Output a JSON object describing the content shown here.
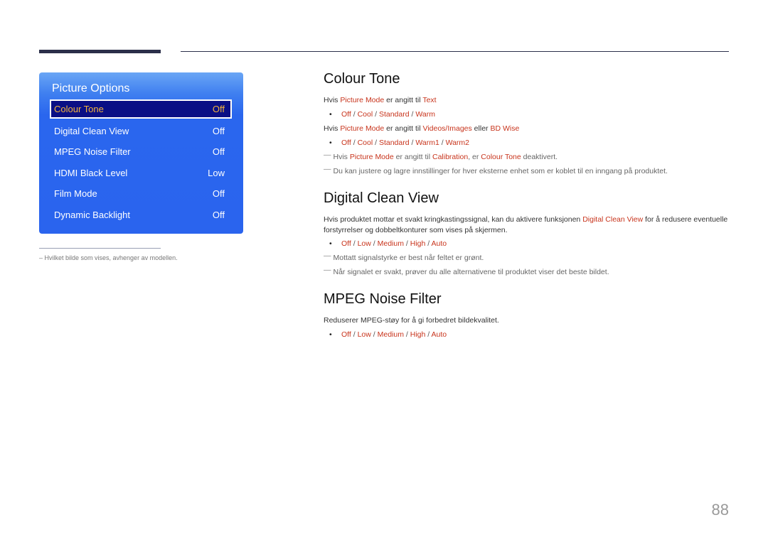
{
  "menu": {
    "title": "Picture Options",
    "items": [
      {
        "label": "Colour Tone",
        "value": "Off",
        "selected": true
      },
      {
        "label": "Digital Clean View",
        "value": "Off"
      },
      {
        "label": "MPEG Noise Filter",
        "value": "Off"
      },
      {
        "label": "HDMI Black Level",
        "value": "Low"
      },
      {
        "label": "Film Mode",
        "value": "Off"
      },
      {
        "label": "Dynamic Backlight",
        "value": "Off"
      }
    ]
  },
  "footnote": "– Hvilket bilde som vises, avhenger av modellen.",
  "sections": {
    "colour_tone": {
      "title": "Colour Tone",
      "cond1": {
        "pre": "Hvis ",
        "hl1": "Picture Mode",
        "mid": " er angitt til ",
        "hl2": "Text"
      },
      "opts1": [
        "Off",
        "Cool",
        "Standard",
        "Warm"
      ],
      "cond2": {
        "pre": "Hvis ",
        "hl1": "Picture Mode",
        "mid": " er angitt til ",
        "hl2": "Videos/Images",
        "mid2": " eller ",
        "hl3": "BD Wise"
      },
      "opts2": [
        "Off",
        "Cool",
        "Standard",
        "Warm1",
        "Warm2"
      ],
      "note1": {
        "pre": "Hvis ",
        "hl1": "Picture Mode",
        "mid": " er angitt til ",
        "hl2": "Calibration",
        "mid2": ", er ",
        "hl3": "Colour Tone",
        "post": " deaktivert."
      },
      "note2": "Du kan justere og lagre innstillinger for hver eksterne enhet som er koblet til en inngang på produktet."
    },
    "digital_clean_view": {
      "title": "Digital Clean View",
      "desc_pre": "Hvis produktet mottar et svakt kringkastingssignal, kan du aktivere funksjonen ",
      "desc_hl": "Digital Clean View",
      "desc_post": " for å redusere eventuelle forstyrrelser og dobbeltkonturer som vises på skjermen.",
      "opts": [
        "Off",
        "Low",
        "Medium",
        "High",
        "Auto"
      ],
      "note1": "Mottatt signalstyrke er best når feltet er grønt.",
      "note2": "Når signalet er svakt, prøver du alle alternativene til produktet viser det beste bildet."
    },
    "mpeg_noise_filter": {
      "title": "MPEG Noise Filter",
      "desc": "Reduserer MPEG-støy for å gi forbedret bildekvalitet.",
      "opts": [
        "Off",
        "Low",
        "Medium",
        "High",
        "Auto"
      ]
    }
  },
  "page_number": "88",
  "colors": {
    "highlight": "#c8341c",
    "menu_blue": "#2a64ee",
    "selected_bg": "#0a0f85",
    "selected_text": "#f2b33d"
  }
}
